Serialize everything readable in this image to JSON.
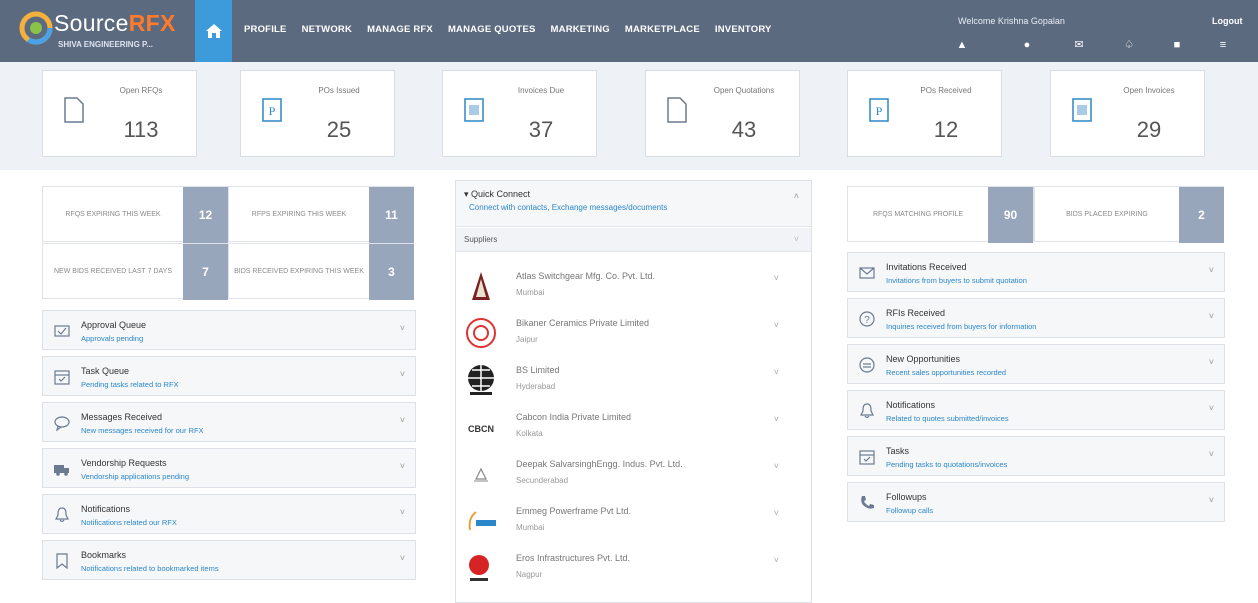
{
  "brand": {
    "name_main": "Source",
    "name_accent": "RFX",
    "company": "SHIVA ENGINEERING P..."
  },
  "colors": {
    "topbar": "#5c6a80",
    "home_active": "#3d9bdb",
    "brand_accent": "#ff7a2a",
    "tile_count": "#98a6bb",
    "link": "#2a87c9"
  },
  "nav": [
    "PROFILE",
    "NETWORK",
    "MANAGE RFX",
    "MANAGE QUOTES",
    "MARKETING",
    "MARKETPLACE",
    "INVENTORY"
  ],
  "header": {
    "welcome": "Welcome Krishna Gopalan",
    "logout": "Logout",
    "icons": [
      "user-icon",
      "gear-icon",
      "mail-icon",
      "bell-icon",
      "chat-icon",
      "menu-icon"
    ]
  },
  "stats": [
    {
      "label": "Open RFQs",
      "value": "113",
      "icon": "document-icon"
    },
    {
      "label": "POs Issued",
      "value": "25",
      "icon": "po-icon"
    },
    {
      "label": "Invoices Due",
      "value": "37",
      "icon": "invoice-icon"
    },
    {
      "label": "Open Quotations",
      "value": "43",
      "icon": "document-icon"
    },
    {
      "label": "POs Received",
      "value": "12",
      "icon": "po-icon"
    },
    {
      "label": "Open Invoices",
      "value": "29",
      "icon": "invoice-icon"
    }
  ],
  "left_tiles": [
    {
      "label": "RFQS EXPIRING THIS WEEK",
      "count": "12"
    },
    {
      "label": "RFPS EXPIRING THIS WEEK",
      "count": "11"
    },
    {
      "label": "NEW BIDS RECEIVED LAST 7 DAYS",
      "count": "7"
    },
    {
      "label": "BIDS RECEIVED EXPIRING THIS WEEK",
      "count": "3"
    }
  ],
  "left_panels": [
    {
      "title": "Approval Queue",
      "subtitle": "Approvals pending",
      "icon": "approval-icon"
    },
    {
      "title": "Task Queue",
      "subtitle": "Pending tasks related to RFX",
      "icon": "calendar-icon"
    },
    {
      "title": "Messages Received",
      "subtitle": "New messages received for our RFX",
      "icon": "chat-bubble-icon"
    },
    {
      "title": "Vendorship Requests",
      "subtitle": "Vendorship applications pending",
      "icon": "truck-icon"
    },
    {
      "title": "Notifications",
      "subtitle": "Notifications related our RFX",
      "icon": "bell-icon"
    },
    {
      "title": "Bookmarks",
      "subtitle": "Notifications related to bookmarked items",
      "icon": "bookmark-icon"
    }
  ],
  "quick_connect": {
    "title": "Quick Connect",
    "subtitle": "Connect with contacts, Exchange messages/documents"
  },
  "suppliers_label": "Suppliers",
  "suppliers": [
    {
      "name": "Atlas Switchgear Mfg. Co. Pvt. Ltd.",
      "city": "Mumbai"
    },
    {
      "name": "Bikaner Ceramics Private Limited",
      "city": "Jaipur"
    },
    {
      "name": "BS Limited",
      "city": "Hyderabad"
    },
    {
      "name": "Cabcon India Private Limited",
      "city": "Kolkata"
    },
    {
      "name": "Deepak SalvarsinghEngg. Indus. Pvt. Ltd.",
      "city": "Secunderabad"
    },
    {
      "name": "Emmeg Powerframe Pvt Ltd.",
      "city": "Mumbai"
    },
    {
      "name": "Eros Infrastructures Pvt. Ltd.",
      "city": "Nagpur"
    }
  ],
  "right_tiles": [
    {
      "label": "RFQS MATCHING PROFILE",
      "count": "90"
    },
    {
      "label": "BIDS PLACED EXPIRING",
      "count": "2"
    }
  ],
  "right_panels": [
    {
      "title": "Invitations Received",
      "subtitle": "Invitations from buyers to submit quotation",
      "icon": "envelope-icon"
    },
    {
      "title": "RFIs Received",
      "subtitle": "Inquiries received from buyers for information",
      "icon": "question-icon"
    },
    {
      "title": "New Opportunities",
      "subtitle": "Recent sales opportunities recorded",
      "icon": "opportunity-icon"
    },
    {
      "title": "Notifications",
      "subtitle": "Related to quotes submitted/invoices",
      "icon": "bell-icon"
    },
    {
      "title": "Tasks",
      "subtitle": "Pending tasks to quotations/invoices",
      "icon": "calendar-icon"
    },
    {
      "title": "Followups",
      "subtitle": "Followup calls",
      "icon": "phone-icon"
    }
  ]
}
